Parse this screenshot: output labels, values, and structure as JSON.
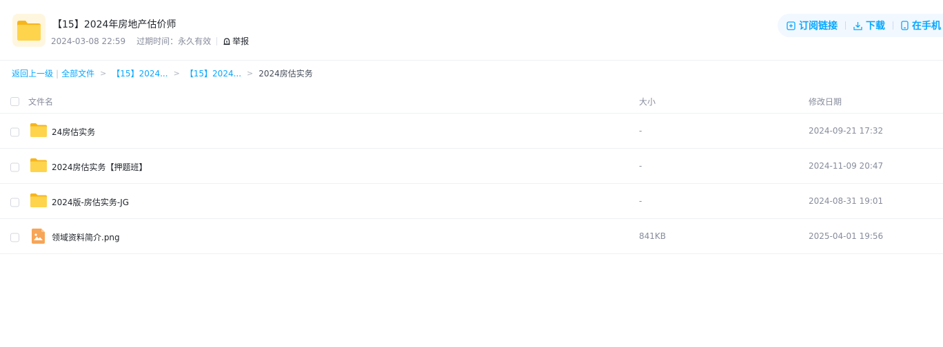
{
  "share": {
    "title": "【15】2024年房地产估价师",
    "date": "2024-03-08 22:59",
    "expiry_label": "过期时间：",
    "expiry_value": "永久有效",
    "report_label": "举报"
  },
  "actions": {
    "subscribe": "订阅链接",
    "download": "下载",
    "phone": "在手机"
  },
  "breadcrumb": {
    "back": "返回上一级",
    "all_files": "全部文件",
    "levels": [
      "【15】2024...",
      "【15】2024..."
    ],
    "current": "2024房估实务"
  },
  "table": {
    "headers": {
      "name": "文件名",
      "size": "大小",
      "date": "修改日期"
    },
    "rows": [
      {
        "name": "24房估实务",
        "size": "-",
        "date": "2024-09-21 17:32",
        "icon": "folder-icon"
      },
      {
        "name": "2024房估实务【押题班】",
        "size": "-",
        "date": "2024-11-09 20:47",
        "icon": "folder-icon"
      },
      {
        "name": "2024版-房估实务-JG",
        "size": "-",
        "date": "2024-08-31 19:01",
        "icon": "folder-icon"
      },
      {
        "name": "领域资料简介.png",
        "size": "841KB",
        "date": "2025-04-01 19:56",
        "icon": "image-file-icon"
      }
    ]
  },
  "colors": {
    "accent": "#06a7ff",
    "folder": "#ffc933",
    "image_file": "#f7a556",
    "muted_text": "#878c9c"
  }
}
